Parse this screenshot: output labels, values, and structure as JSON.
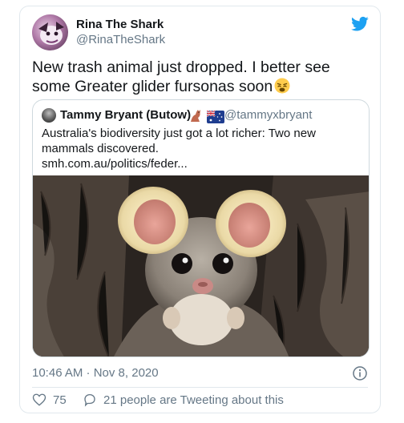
{
  "author": {
    "display_name": "Rina The Shark",
    "handle": "@RinaTheShark"
  },
  "tweet": {
    "text": "New trash animal just dropped. I better see some Greater glider fursonas soon",
    "emoji": "weary-face-emoji"
  },
  "quoted": {
    "display_name": "Tammy Bryant (Butow)",
    "flags": "🦘 🇦🇺",
    "handle": "@tammyxbryant",
    "text": "Australia's biodiversity just got a lot richer: Two new mammals discovered.",
    "link": "smh.com.au/politics/feder...",
    "image": "greater-glider-photo"
  },
  "timestamp": "10:46 AM · Nov 8, 2020",
  "stats": {
    "likes": "75",
    "tweeting": "21 people are Tweeting about this"
  },
  "icons": {
    "brand": "twitter-bird-icon",
    "info": "info-icon",
    "like": "heart-icon",
    "reply": "speech-bubble-icon"
  },
  "colors": {
    "brand_blue": "#1da1f2",
    "secondary_text": "#657786",
    "border": "#e1e8ed"
  }
}
